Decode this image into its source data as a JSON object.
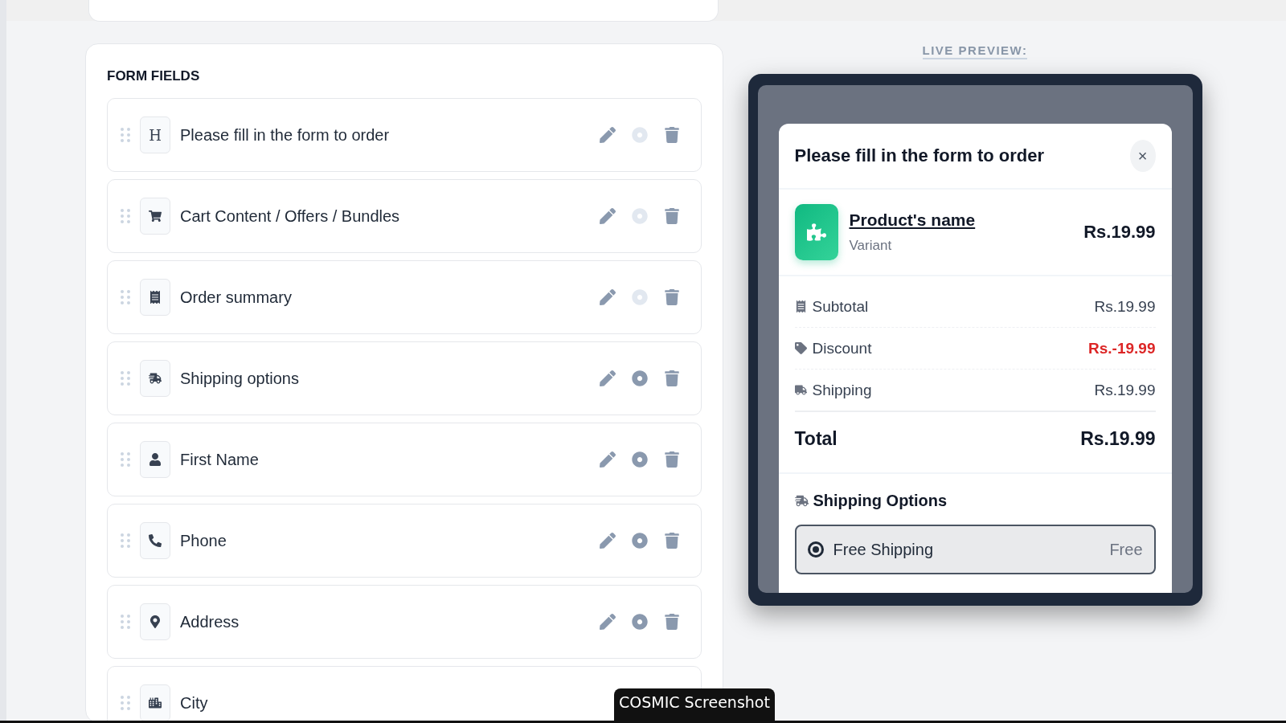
{
  "form_fields": {
    "title": "FORM FIELDS",
    "items": [
      {
        "kind": "heading",
        "icon_char": "H",
        "label": "Please fill in the form to order",
        "visible": false
      },
      {
        "kind": "cart",
        "label": "Cart Content / Offers / Bundles",
        "visible": false
      },
      {
        "kind": "summary",
        "label": "Order summary",
        "visible": false
      },
      {
        "kind": "shipping",
        "label": "Shipping options",
        "visible": true
      },
      {
        "kind": "name",
        "label": "First Name",
        "visible": true
      },
      {
        "kind": "phone",
        "label": "Phone",
        "visible": true
      },
      {
        "kind": "address",
        "label": "Address",
        "visible": true
      },
      {
        "kind": "city",
        "label": "City"
      }
    ]
  },
  "preview": {
    "label": "LIVE PREVIEW:",
    "modal": {
      "title": "Please fill in the form to order",
      "close": "×",
      "product": {
        "name": "Product's name",
        "variant": "Variant",
        "price": "Rs.19.99"
      },
      "lines": [
        {
          "kind": "subtotal",
          "label": "Subtotal",
          "value": "Rs.19.99",
          "negative": false
        },
        {
          "kind": "discount",
          "label": "Discount",
          "value": "Rs.-19.99",
          "negative": true
        },
        {
          "kind": "shipping",
          "label": "Shipping",
          "value": "Rs.19.99",
          "negative": false
        }
      ],
      "total": {
        "label": "Total",
        "value": "Rs.19.99"
      },
      "shipping_options": {
        "title": "Shipping Options",
        "options": [
          {
            "label": "Free Shipping",
            "price": "Free",
            "selected": true
          }
        ]
      }
    }
  },
  "tooltip": "COSMIC Screenshot"
}
